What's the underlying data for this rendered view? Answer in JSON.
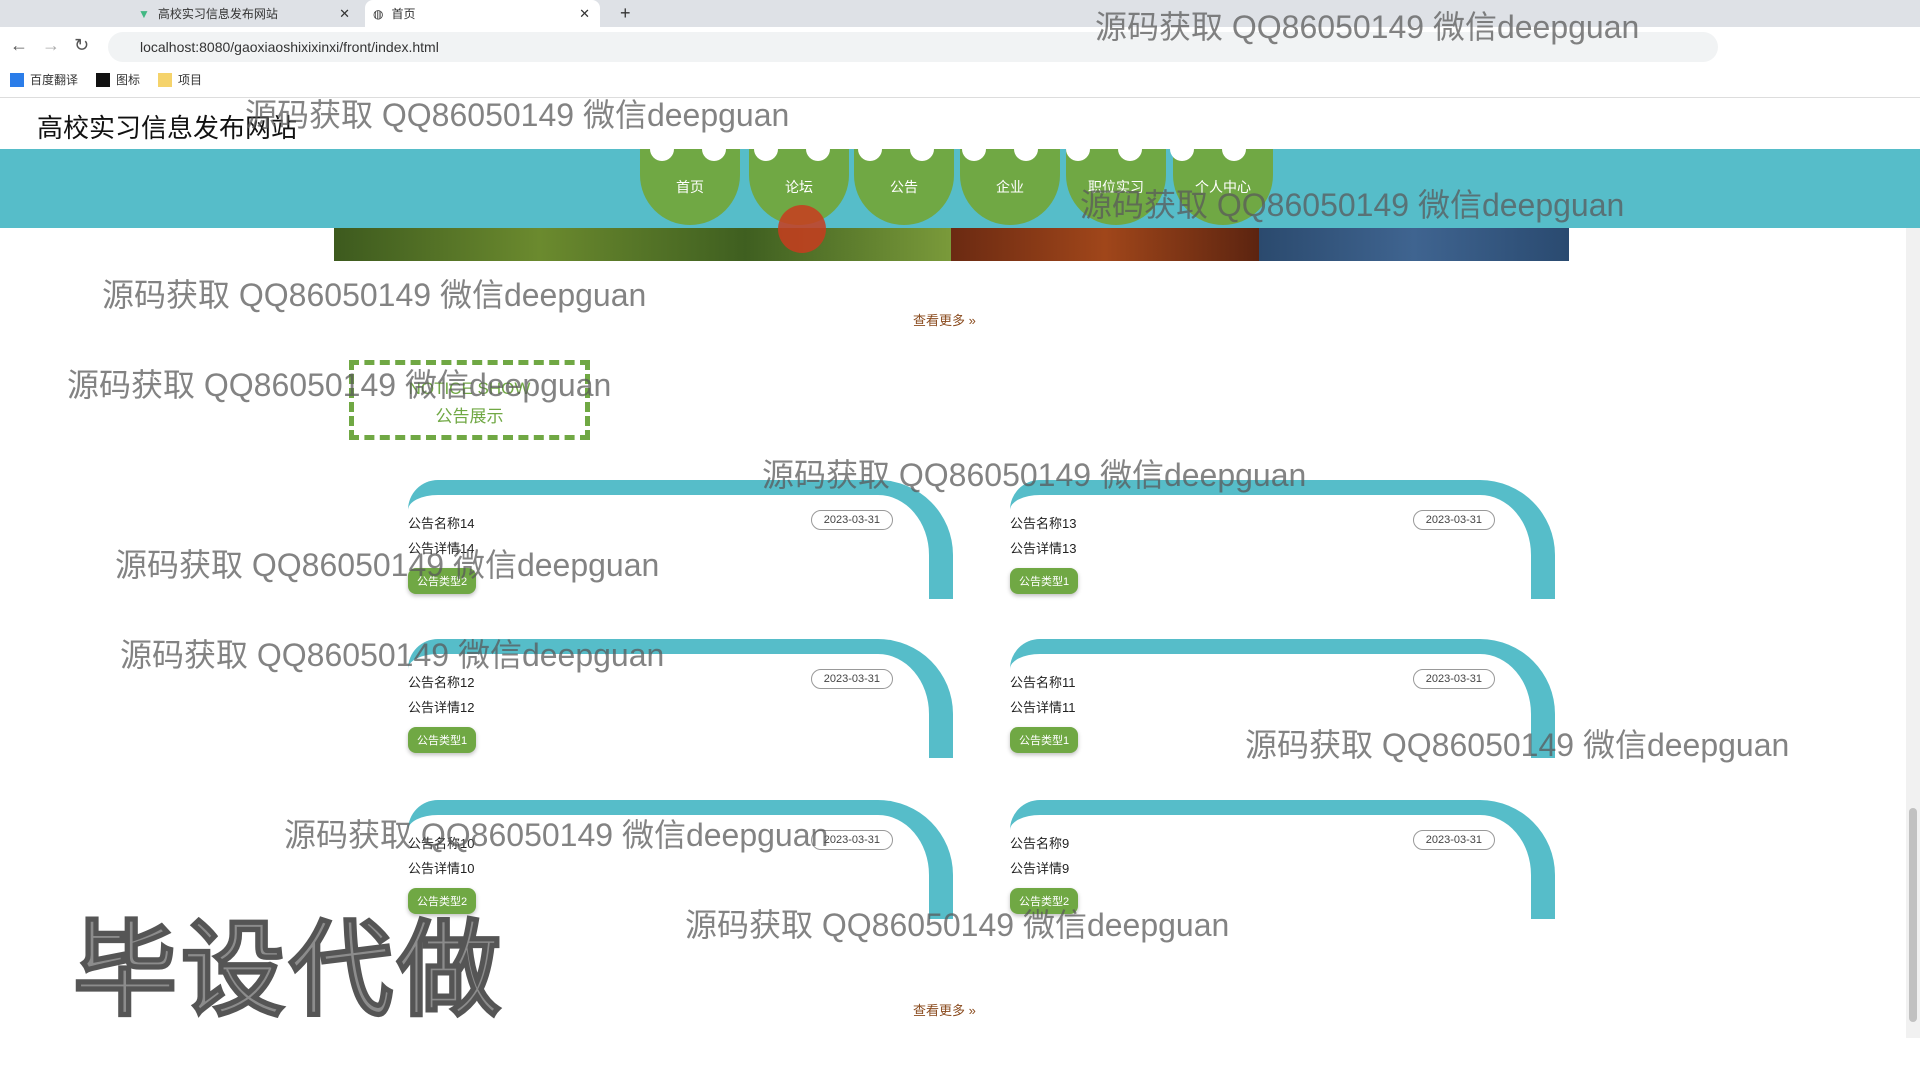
{
  "browser": {
    "tabs": [
      {
        "label": "高校实习信息发布网站"
      },
      {
        "label": "首页"
      }
    ],
    "new_tab": "+",
    "url": "localhost:8080/gaoxiaoshixixinxi/front/index.html",
    "bookmarks": [
      "百度翻译",
      "图标",
      "项目"
    ]
  },
  "site": {
    "title": "高校实习信息发布网站"
  },
  "nav": [
    "首页",
    "论坛",
    "公告",
    "企业",
    "职位实习",
    "个人中心"
  ],
  "more_label": "查看更多 »",
  "section": {
    "title_en": "NOTICE SHOW",
    "title_cn": "公告展示"
  },
  "notices": [
    {
      "name": "公告名称14",
      "detail": "公告详情14",
      "date": "2023-03-31",
      "type": "公告类型2"
    },
    {
      "name": "公告名称13",
      "detail": "公告详情13",
      "date": "2023-03-31",
      "type": "公告类型1"
    },
    {
      "name": "公告名称12",
      "detail": "公告详情12",
      "date": "2023-03-31",
      "type": "公告类型1"
    },
    {
      "name": "公告名称11",
      "detail": "公告详情11",
      "date": "2023-03-31",
      "type": "公告类型1"
    },
    {
      "name": "公告名称10",
      "detail": "公告详情10",
      "date": "2023-03-31",
      "type": "公告类型2"
    },
    {
      "name": "公告名称9",
      "detail": "公告详情9",
      "date": "2023-03-31",
      "type": "公告类型2"
    }
  ],
  "watermark": "源码获取 QQ86050149 微信deepguan",
  "big_watermark": "毕设代做",
  "colors": {
    "teal": "#56bdc9",
    "green": "#70a844"
  }
}
